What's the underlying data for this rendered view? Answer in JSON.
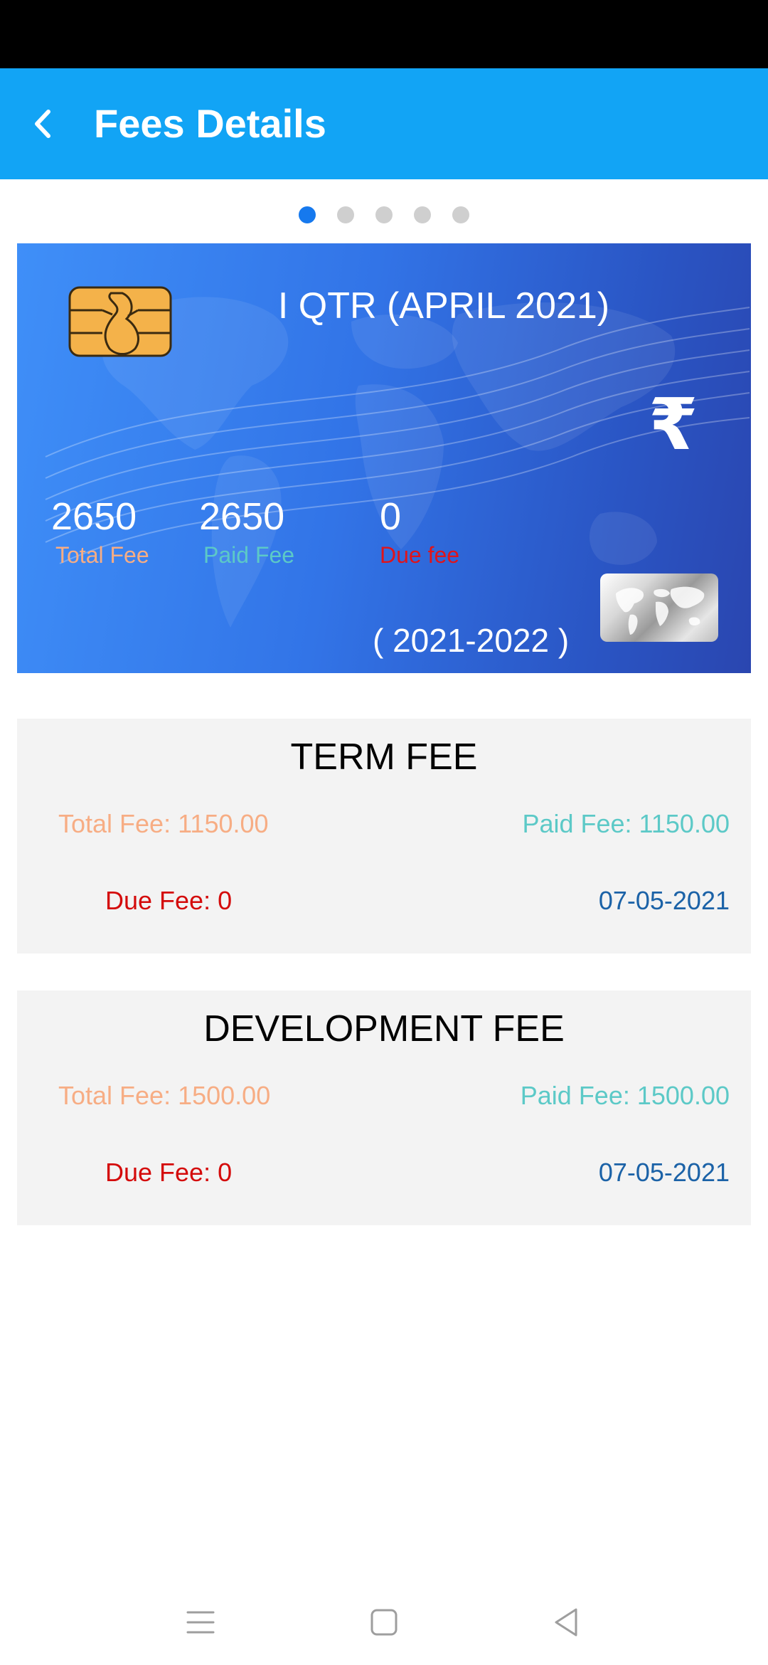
{
  "app_bar": {
    "title": "Fees Details",
    "back_icon": "chevron-left-icon",
    "color": "#12a4f5"
  },
  "pager": {
    "page_count": 5,
    "active_index": 0,
    "active_color": "#1679ee",
    "inactive_color": "#cfcfcf"
  },
  "card": {
    "quarter": "I QTR (APRIL 2021)",
    "currency_symbol": "₹",
    "total_fee": "2650",
    "total_fee_label": "Total Fee",
    "paid_fee": "2650",
    "paid_fee_label": "Paid Fee",
    "due_fee": "0",
    "due_fee_label": "Due fee",
    "year": "( 2021-2022 )",
    "chip_icon": "sim-chip-icon",
    "world_card_icon": "world-map-card-icon"
  },
  "sections": [
    {
      "title": "TERM FEE",
      "total_fee": "Total Fee: 1150.00",
      "paid_fee": "Paid Fee: 1150.00",
      "due_fee": "Due Fee: 0",
      "date": "07-05-2021"
    },
    {
      "title": "DEVELOPMENT FEE",
      "total_fee": "Total Fee: 1500.00",
      "paid_fee": "Paid Fee: 1500.00",
      "due_fee": "Due Fee: 0",
      "date": "07-05-2021"
    }
  ],
  "colors": {
    "total_fee": "#f7ad84",
    "paid_fee": "#5cc9c7",
    "due_fee": "#d40b0b",
    "date": "#1b62a7"
  },
  "nav_bar": {
    "menu_icon": "menu-icon",
    "home_icon": "home-square-icon",
    "back_icon": "back-triangle-icon"
  }
}
